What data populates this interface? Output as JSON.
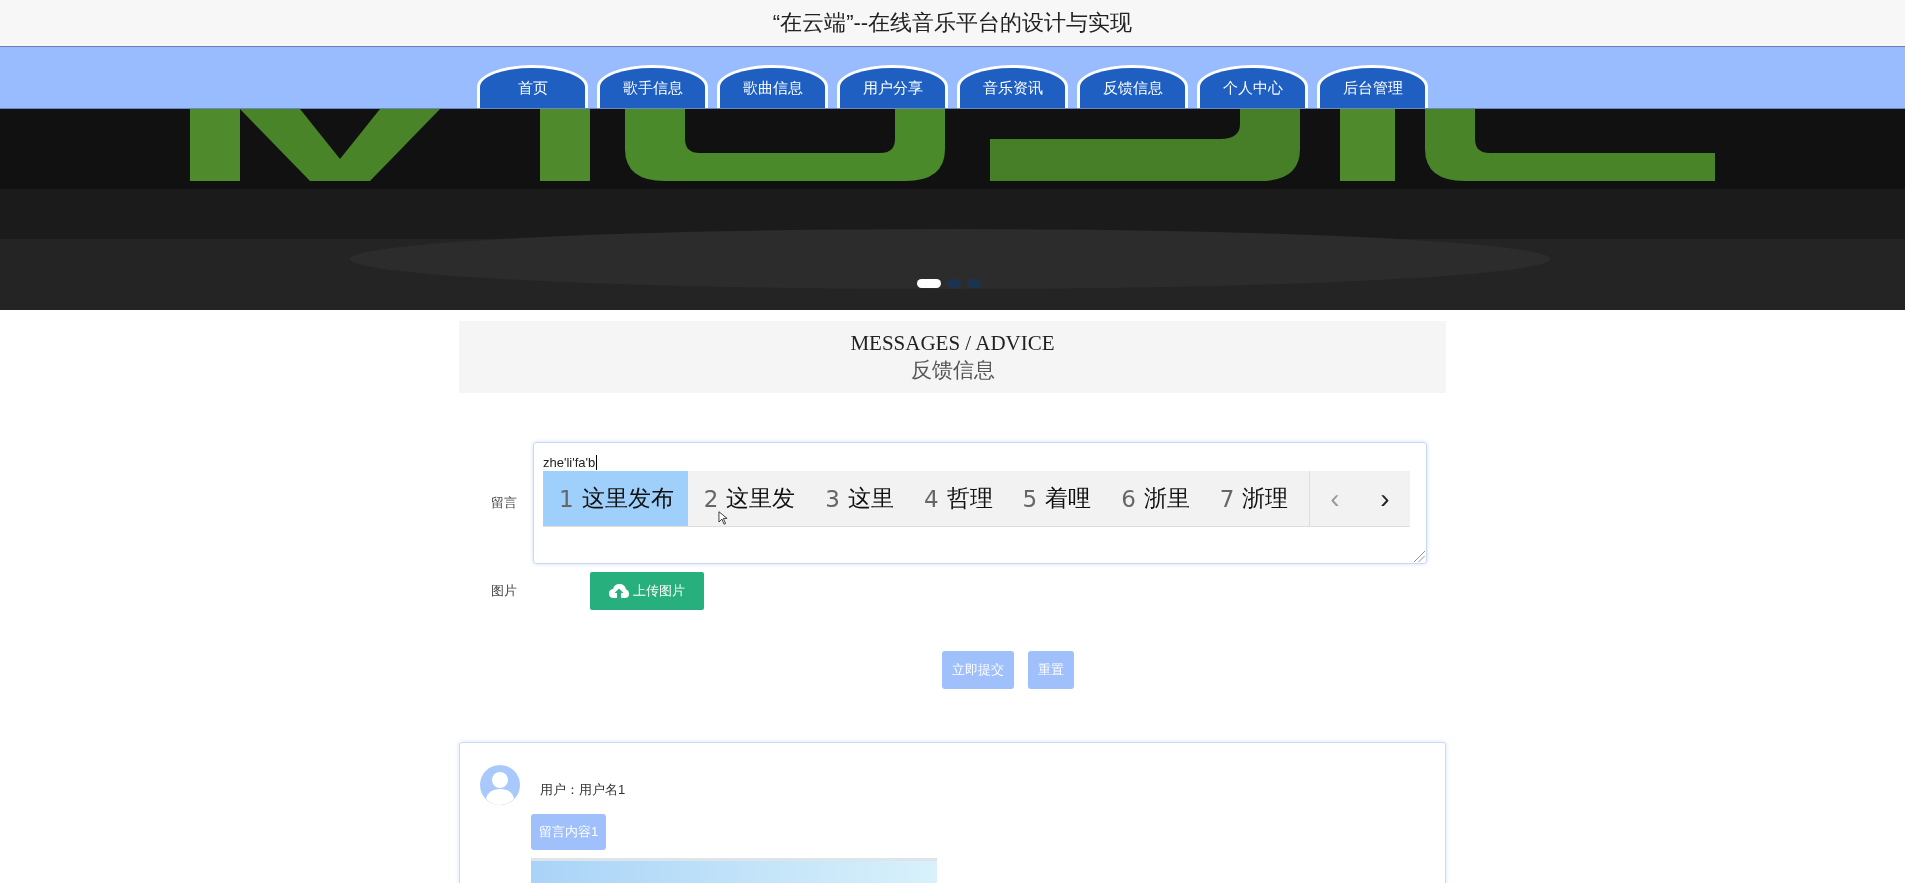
{
  "header": {
    "title": "“在云端”--在线音乐平台的设计与实现"
  },
  "nav": [
    {
      "label": "首页"
    },
    {
      "label": "歌手信息"
    },
    {
      "label": "歌曲信息"
    },
    {
      "label": "用户分享"
    },
    {
      "label": "音乐资讯"
    },
    {
      "label": "反馈信息"
    },
    {
      "label": "个人中心"
    },
    {
      "label": "后台管理"
    }
  ],
  "banner": {
    "kind": "picture",
    "dots": [
      {
        "selected": true
      },
      {
        "selected": false
      },
      {
        "selected": false
      }
    ]
  },
  "section": {
    "title_en": "MESSAGES / ADVICE",
    "title_cn": "反馈信息"
  },
  "form": {
    "message_label": "留言",
    "message_value": "zhe'li'fa'b",
    "image_label": "图片",
    "upload_button": "上传图片",
    "submit_button": "立即提交",
    "reset_button": "重置"
  },
  "ime": {
    "candidates": [
      {
        "number": "1",
        "text": "这里发布",
        "selected": true
      },
      {
        "number": "2",
        "text": "这里发",
        "selected": false
      },
      {
        "number": "3",
        "text": "这里",
        "selected": false
      },
      {
        "number": "4",
        "text": "哲理",
        "selected": false
      },
      {
        "number": "5",
        "text": "着哩",
        "selected": false
      },
      {
        "number": "6",
        "text": "浙里",
        "selected": false
      },
      {
        "number": "7",
        "text": "浙理",
        "selected": false
      }
    ],
    "prev": "‹",
    "next": "›"
  },
  "comments": [
    {
      "user": "用户：用户名1",
      "content": "留言内容1"
    }
  ]
}
